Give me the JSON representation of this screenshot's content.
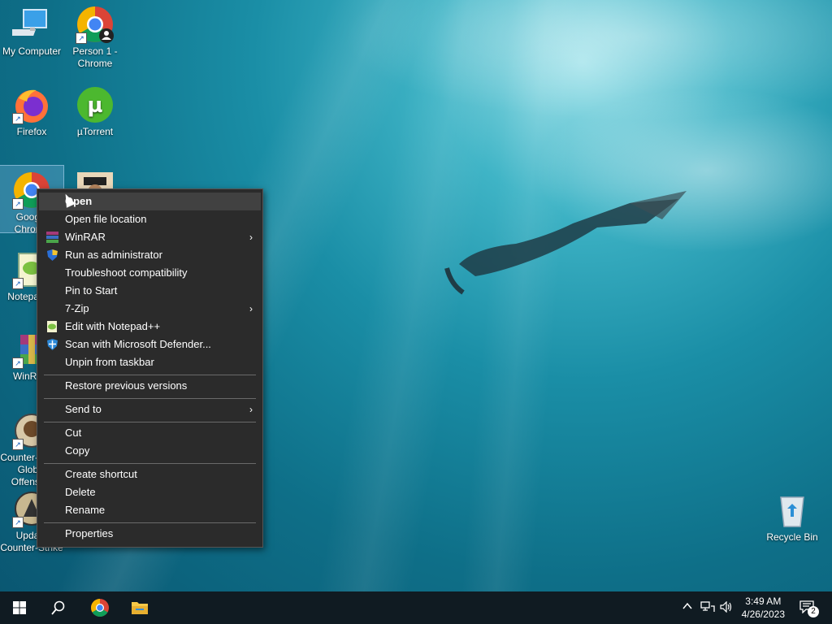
{
  "desktop": {
    "icons": [
      {
        "label": "My Computer"
      },
      {
        "label": "Person 1 - Chrome"
      },
      {
        "label": "Firefox"
      },
      {
        "label": "µTorrent"
      },
      {
        "label": "Google Chrome"
      },
      {
        "label": "Notepad++"
      },
      {
        "label": "WinRAR"
      },
      {
        "label": "Counter-Strike Global Offensive"
      },
      {
        "label": "Update Counter-Strike"
      },
      {
        "label": "Recycle Bin"
      }
    ]
  },
  "context_menu": {
    "items": {
      "open": "Open",
      "open_file_location": "Open file location",
      "winrar": "WinRAR",
      "run_as_admin": "Run as administrator",
      "troubleshoot": "Troubleshoot compatibility",
      "pin_start": "Pin to Start",
      "seven_zip": "7-Zip",
      "edit_notepad": "Edit with Notepad++",
      "scan_defender": "Scan with Microsoft Defender...",
      "unpin_taskbar": "Unpin from taskbar",
      "restore_versions": "Restore previous versions",
      "send_to": "Send to",
      "cut": "Cut",
      "copy": "Copy",
      "create_shortcut": "Create shortcut",
      "delete": "Delete",
      "rename": "Rename",
      "properties": "Properties"
    },
    "submenu_arrow": "›"
  },
  "taskbar": {
    "time": "3:49 AM",
    "date": "4/26/2023",
    "notification_count": "2"
  }
}
